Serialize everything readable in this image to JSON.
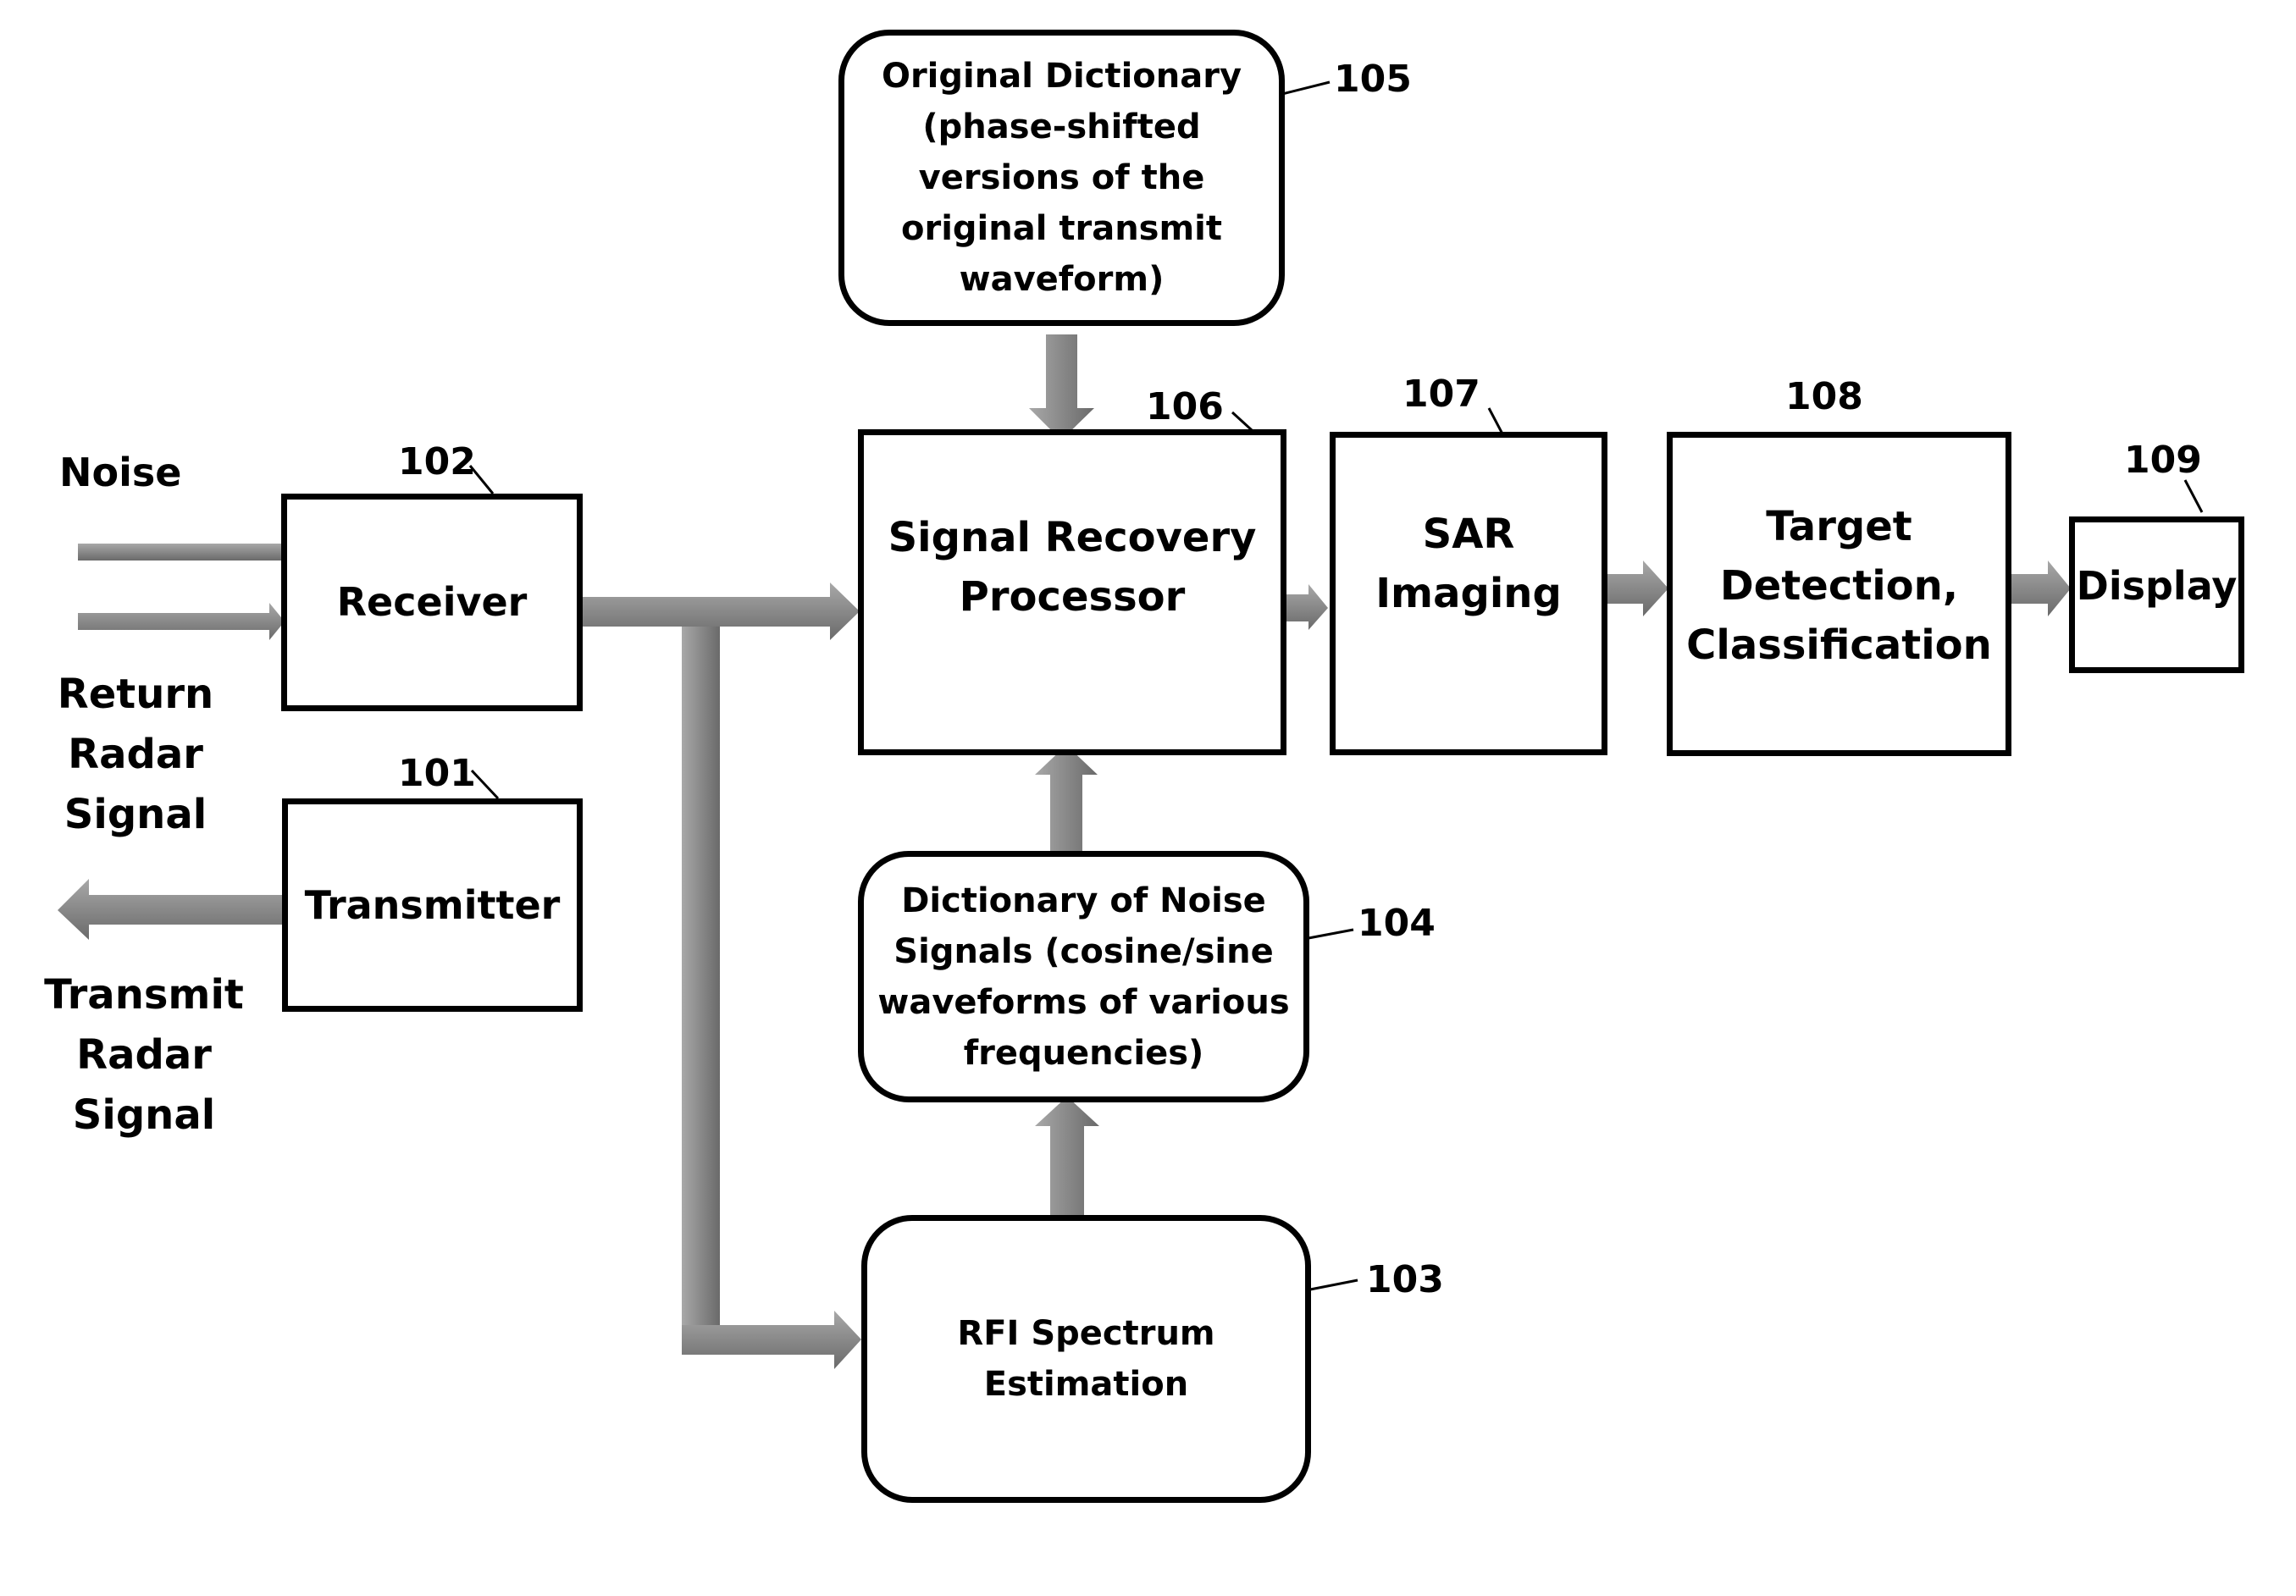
{
  "diagram": {
    "blocks": {
      "transmitter": {
        "ref": "101",
        "text": "Transmitter"
      },
      "receiver": {
        "ref": "102",
        "text": "Receiver"
      },
      "rfi_estimation": {
        "ref": "103",
        "text": "RFI Spectrum\nEstimation"
      },
      "noise_dictionary": {
        "ref": "104",
        "text": "Dictionary of Noise\nSignals (cosine/sine\nwaveforms of various\nfrequencies)"
      },
      "original_dictionary": {
        "ref": "105",
        "text": "Original Dictionary\n(phase-shifted\nversions of  the\noriginal transmit\nwaveform)"
      },
      "signal_recovery": {
        "ref": "106",
        "text": "Signal Recovery\nProcessor"
      },
      "sar_imaging": {
        "ref": "107",
        "text": "SAR\nImaging"
      },
      "target_detection": {
        "ref": "108",
        "text": "Target\nDetection,\nClassification"
      },
      "display": {
        "ref": "109",
        "text": "Display"
      }
    },
    "external_labels": {
      "noise": "Noise",
      "return_signal": "Return\nRadar\nSignal",
      "transmit_signal": "Transmit\nRadar\nSignal"
    },
    "connections": [
      {
        "from": "noise",
        "to": "receiver"
      },
      {
        "from": "return_signal",
        "to": "receiver"
      },
      {
        "from": "transmitter",
        "to": "transmit_signal"
      },
      {
        "from": "receiver",
        "to": "signal_recovery"
      },
      {
        "from": "receiver",
        "to": "rfi_estimation"
      },
      {
        "from": "rfi_estimation",
        "to": "noise_dictionary"
      },
      {
        "from": "noise_dictionary",
        "to": "signal_recovery"
      },
      {
        "from": "original_dictionary",
        "to": "signal_recovery"
      },
      {
        "from": "signal_recovery",
        "to": "sar_imaging"
      },
      {
        "from": "sar_imaging",
        "to": "target_detection"
      },
      {
        "from": "target_detection",
        "to": "display"
      }
    ],
    "colors": {
      "arrow_fill": "#8a8a8a",
      "arrow_dark": "#6e6e6e",
      "stroke": "#000000",
      "background": "#ffffff"
    }
  }
}
